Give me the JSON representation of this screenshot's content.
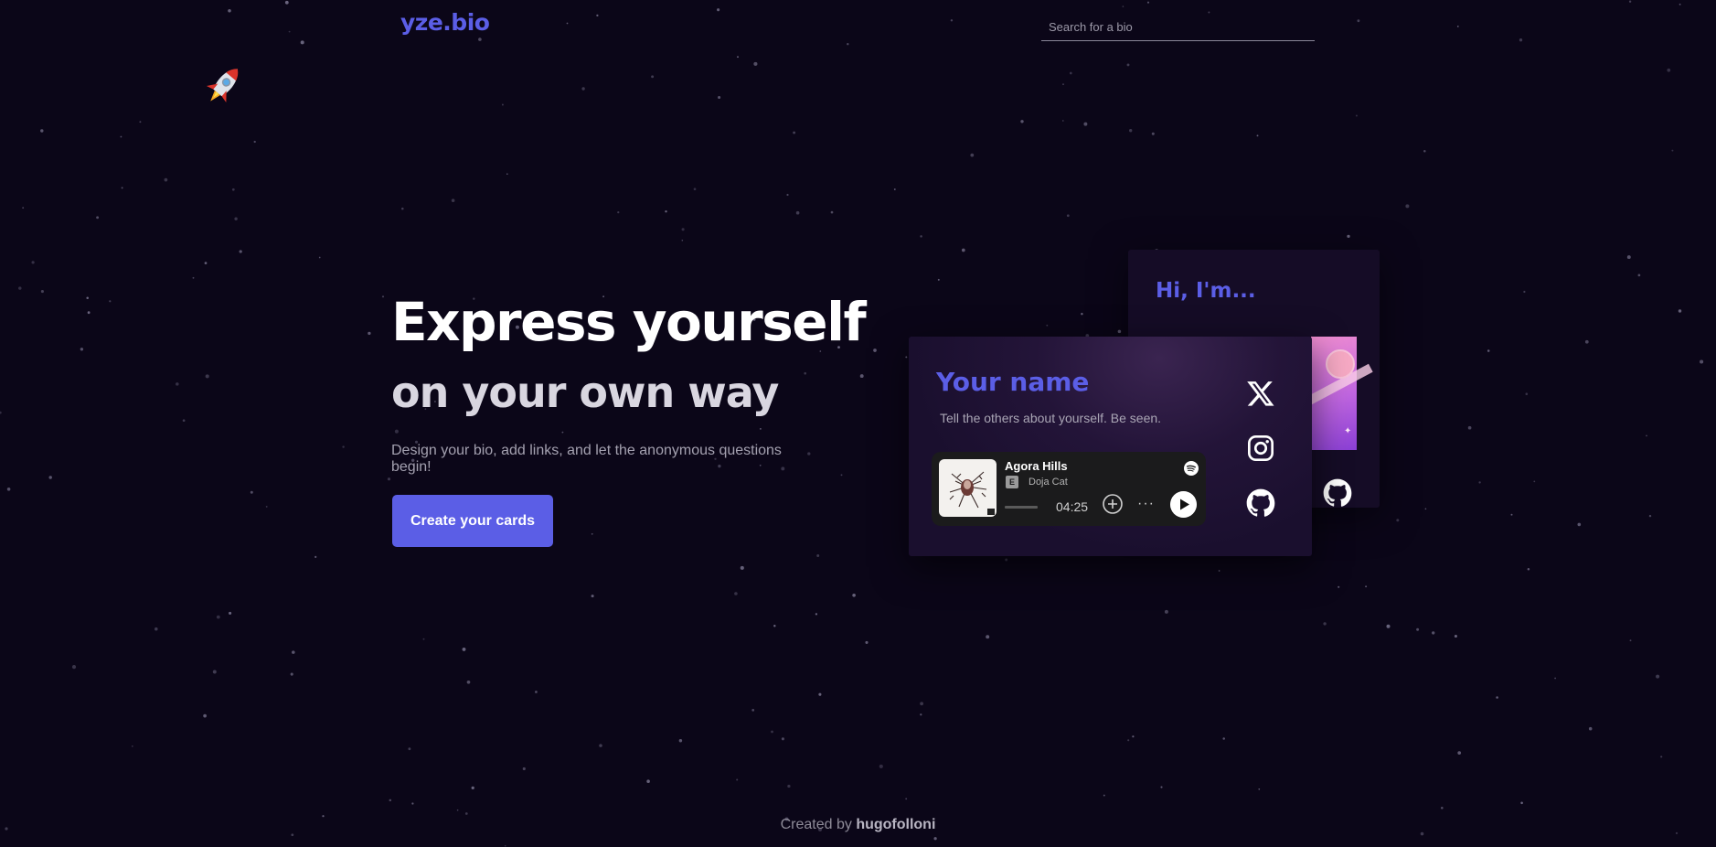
{
  "header": {
    "logo": "yze.bio",
    "search_placeholder": "Search for a bio",
    "rocket_icon": "rocket-emoji"
  },
  "hero": {
    "title": "Express yourself",
    "subtitle": "on your own way",
    "description": "Design your bio, add links, and let the anonymous questions begin!",
    "cta_label": "Create your cards"
  },
  "back_card": {
    "greeting": "Hi, I'm...",
    "icon": "github-icon"
  },
  "front_card": {
    "name": "Your name",
    "bio": "Tell the others about yourself. Be seen.",
    "social_icons": [
      "x-icon",
      "instagram-icon",
      "github-icon"
    ],
    "spotify": {
      "track": "Agora Hills",
      "explicit_badge": "E",
      "artist": "Doja Cat",
      "duration": "04:25",
      "more_label": "···",
      "icons": [
        "spotify-logo-icon",
        "add-circle-icon",
        "more-icon",
        "play-icon"
      ]
    }
  },
  "footer": {
    "prefix": "Created by",
    "author": "hugofolloni"
  },
  "colors": {
    "background": "#0b0618",
    "accent": "#5b5ee6",
    "card": "#1a0f2e",
    "player": "#1b1b1c"
  }
}
